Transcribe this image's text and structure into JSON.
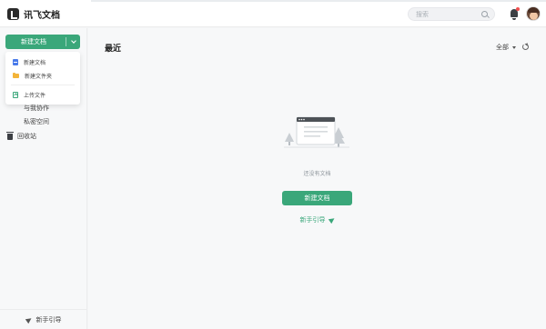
{
  "header": {
    "app_name": "讯飞文档",
    "search_placeholder": "搜索"
  },
  "sidebar": {
    "new_button_label": "新建文档",
    "dropdown": [
      {
        "label": "新建文档",
        "icon": "document-icon"
      },
      {
        "label": "新建文件夹",
        "icon": "folder-icon"
      },
      {
        "label": "上传文件",
        "icon": "upload-icon"
      }
    ],
    "nav": [
      {
        "label": "与我协作"
      },
      {
        "label": "私密空间"
      },
      {
        "label": "回收站",
        "icon": "trash-icon"
      }
    ],
    "guide_label": "新手引导"
  },
  "main": {
    "title": "最近",
    "filter_label": "全部",
    "empty_text": "还没有文档",
    "cta_label": "新建文档",
    "guide_label": "新手引导"
  },
  "colors": {
    "accent": "#3aa77a",
    "folder": "#f3b43a",
    "doc": "#4a7bea"
  }
}
